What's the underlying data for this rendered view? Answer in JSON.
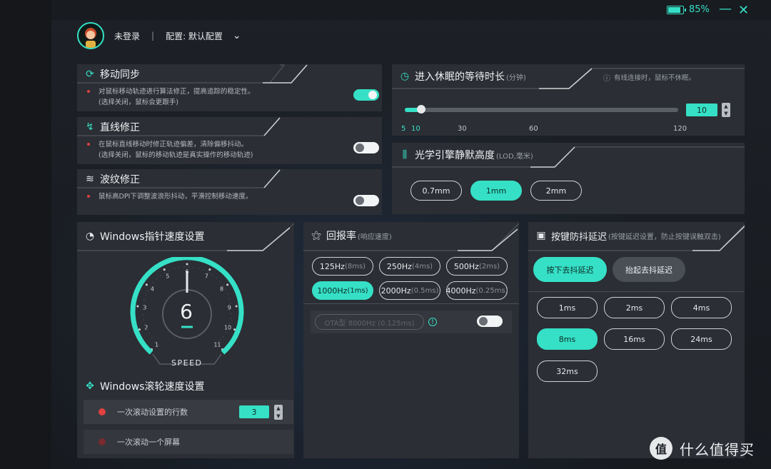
{
  "window": {
    "battery_pct": "85%",
    "battery_level": 0.85
  },
  "user": {
    "name": "未登录",
    "separator": "|",
    "config_label": "配置: 默认配置"
  },
  "mobile_sync": {
    "title": "移动同步",
    "desc_line1": "对鼠标移动轨迹进行算法修正，提高追踪的稳定性。",
    "desc_line2": "(选择关闭，鼠标会更跟手)",
    "enabled": true
  },
  "angle_snap": {
    "title": "直线修正",
    "desc_line1": "在鼠标直线移动时修正轨迹偏差，清除偏移抖动。",
    "desc_line2": "(选择关闭，鼠标的移动轨迹是真实操作的移动轨迹)",
    "enabled": false
  },
  "ripple": {
    "title": "波纹修正",
    "desc_line1": "鼠标高DPI下调整波浪形抖动，平滑控制移动速度。",
    "enabled": false
  },
  "sleep": {
    "title": "进入休眠的等待时长",
    "unit": "(分钟)",
    "note": "有线连接时，鼠标不休眠。",
    "value": "10",
    "value_num": 10,
    "min": 5,
    "max": 120,
    "ticks": [
      "5",
      "10",
      "30",
      "60",
      "120"
    ]
  },
  "lod": {
    "title": "光学引擎静默高度",
    "unit": "(LOD,毫米)",
    "options": [
      "0.7mm",
      "1mm",
      "2mm"
    ],
    "selected": "1mm"
  },
  "pointer": {
    "title": "Windows指针速度设置",
    "value": "6",
    "gauge_fraction": 0.5,
    "speed_label": "SPEED",
    "dial_ticks": [
      "1",
      "2",
      "3",
      "4",
      "5",
      "6",
      "7",
      "8",
      "9",
      "10",
      "11"
    ]
  },
  "scroll": {
    "title": "Windows滚轮速度设置",
    "option_lines": "一次滚动设置的行数",
    "lines_value": "3",
    "option_screen": "一次滚动一个屏幕"
  },
  "polling": {
    "title": "回报率",
    "unit": "(响应速度)",
    "options": [
      {
        "hz": "125Hz",
        "ms": "(8ms)"
      },
      {
        "hz": "250Hz",
        "ms": "(4ms)"
      },
      {
        "hz": "500Hz",
        "ms": "(2ms)"
      },
      {
        "hz": "1000Hz",
        "ms": "(1ms)"
      },
      {
        "hz": "2000Hz",
        "ms": "(0.5ms)"
      },
      {
        "hz": "4000Hz",
        "ms": "(0.25ms)"
      }
    ],
    "selected": "1000Hz",
    "ota": "OTA型 8000Hz (0.125ms)",
    "ota_enabled": false
  },
  "debounce": {
    "title": "按键防抖延迟",
    "subtitle": "(按键延迟设置，防止按键误触双击)",
    "tab_press": "按下去抖延迟",
    "tab_release": "抬起去抖延迟",
    "options": [
      "1ms",
      "2ms",
      "4ms",
      "8ms",
      "16ms",
      "24ms",
      "32ms"
    ],
    "selected": "8ms"
  },
  "watermark": {
    "logo": "值",
    "text": "什么值得买"
  },
  "colors": {
    "accent": "#35e0c6",
    "panel": "#2b2e34",
    "bg": "#1b1e23",
    "danger": "#e04040"
  }
}
